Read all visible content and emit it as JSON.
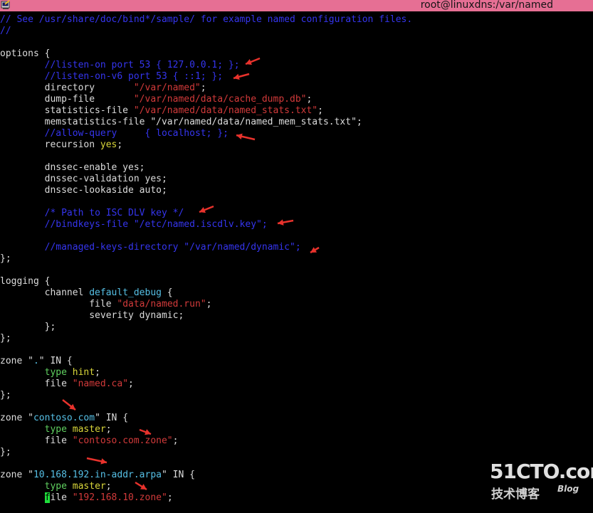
{
  "window": {
    "title": "root@linuxdns:/var/named",
    "icon": "putty-terminal-icon",
    "titlebar_color": "#e66f94"
  },
  "terminal": {
    "lines": [
      [
        {
          "t": "// See /usr/share/doc/bind*/sample/ for example named configuration files.",
          "c": "comment"
        }
      ],
      [
        {
          "t": "//",
          "c": "comment"
        }
      ],
      [],
      [
        {
          "t": "options {",
          "c": "kw"
        }
      ],
      [
        {
          "t": "        ",
          "c": "kw"
        },
        {
          "t": "//listen-on port 53 { 127.0.0.1; };",
          "c": "comment"
        }
      ],
      [
        {
          "t": "        ",
          "c": "kw"
        },
        {
          "t": "//listen-on-v6 port 53 { ::1; };",
          "c": "comment"
        }
      ],
      [
        {
          "t": "        directory       ",
          "c": "kw"
        },
        {
          "t": "\"/var/named\"",
          "c": "str"
        },
        {
          "t": ";",
          "c": "kw"
        }
      ],
      [
        {
          "t": "        dump-file       ",
          "c": "kw"
        },
        {
          "t": "\"/var/named/data/cache_dump.db\"",
          "c": "str"
        },
        {
          "t": ";",
          "c": "kw"
        }
      ],
      [
        {
          "t": "        statistics-file ",
          "c": "kw"
        },
        {
          "t": "\"/var/named/data/named_stats.txt\"",
          "c": "str"
        },
        {
          "t": ";",
          "c": "kw"
        }
      ],
      [
        {
          "t": "        memstatistics-file \"/var/named/data/named_mem_stats.txt\";",
          "c": "kw"
        }
      ],
      [
        {
          "t": "        ",
          "c": "kw"
        },
        {
          "t": "//allow-query     { localhost; };",
          "c": "comment"
        }
      ],
      [
        {
          "t": "        recursion ",
          "c": "kw"
        },
        {
          "t": "yes",
          "c": "val"
        },
        {
          "t": ";",
          "c": "kw"
        }
      ],
      [],
      [
        {
          "t": "        dnssec-enable yes;",
          "c": "kw"
        }
      ],
      [
        {
          "t": "        dnssec-validation yes;",
          "c": "kw"
        }
      ],
      [
        {
          "t": "        dnssec-lookaside auto;",
          "c": "kw"
        }
      ],
      [],
      [
        {
          "t": "        ",
          "c": "kw"
        },
        {
          "t": "/* Path to ISC DLV key */",
          "c": "comment"
        }
      ],
      [
        {
          "t": "        ",
          "c": "kw"
        },
        {
          "t": "//bindkeys-file \"/etc/named.iscdlv.key\";",
          "c": "comment"
        }
      ],
      [],
      [
        {
          "t": "        ",
          "c": "kw"
        },
        {
          "t": "//managed-keys-directory \"/var/named/dynamic\";",
          "c": "comment"
        }
      ],
      [
        {
          "t": "};",
          "c": "kw"
        }
      ],
      [],
      [
        {
          "t": "logging {",
          "c": "kw"
        }
      ],
      [
        {
          "t": "        channel ",
          "c": "kw"
        },
        {
          "t": "default_debug",
          "c": "blue"
        },
        {
          "t": " {",
          "c": "kw"
        }
      ],
      [
        {
          "t": "                file ",
          "c": "kw"
        },
        {
          "t": "\"data/named.run\"",
          "c": "str"
        },
        {
          "t": ";",
          "c": "kw"
        }
      ],
      [
        {
          "t": "                severity dynamic;",
          "c": "kw"
        }
      ],
      [
        {
          "t": "        };",
          "c": "kw"
        }
      ],
      [
        {
          "t": "};",
          "c": "kw"
        }
      ],
      [],
      [
        {
          "t": "zone \"",
          "c": "kw"
        },
        {
          "t": ".",
          "c": "blue"
        },
        {
          "t": "\" IN {",
          "c": "kw"
        }
      ],
      [
        {
          "t": "        ",
          "c": "kw"
        },
        {
          "t": "type",
          "c": "green"
        },
        {
          "t": " ",
          "c": "kw"
        },
        {
          "t": "hint",
          "c": "val"
        },
        {
          "t": ";",
          "c": "kw"
        }
      ],
      [
        {
          "t": "        file ",
          "c": "kw"
        },
        {
          "t": "\"named.ca\"",
          "c": "str"
        },
        {
          "t": ";",
          "c": "kw"
        }
      ],
      [
        {
          "t": "};",
          "c": "kw"
        }
      ],
      [],
      [
        {
          "t": "zone \"",
          "c": "kw"
        },
        {
          "t": "contoso.com",
          "c": "blue"
        },
        {
          "t": "\" IN {",
          "c": "kw"
        }
      ],
      [
        {
          "t": "        ",
          "c": "kw"
        },
        {
          "t": "type",
          "c": "green"
        },
        {
          "t": " ",
          "c": "kw"
        },
        {
          "t": "master",
          "c": "val"
        },
        {
          "t": ";",
          "c": "kw"
        }
      ],
      [
        {
          "t": "        file ",
          "c": "kw"
        },
        {
          "t": "\"contoso.com.zone\"",
          "c": "str"
        },
        {
          "t": ";",
          "c": "kw"
        }
      ],
      [
        {
          "t": "};",
          "c": "kw"
        }
      ],
      [],
      [
        {
          "t": "zone \"",
          "c": "kw"
        },
        {
          "t": "10.168.192.in-addr.arpa",
          "c": "blue"
        },
        {
          "t": "\" IN {",
          "c": "kw"
        }
      ],
      [
        {
          "t": "        ",
          "c": "kw"
        },
        {
          "t": "type",
          "c": "green"
        },
        {
          "t": " ",
          "c": "kw"
        },
        {
          "t": "master",
          "c": "val"
        },
        {
          "t": ";",
          "c": "kw"
        }
      ],
      [
        {
          "t": "        ",
          "c": "kw"
        },
        {
          "t": "f",
          "c": "cursor"
        },
        {
          "t": "ile ",
          "c": "kw"
        },
        {
          "t": "\"192.168.10.zone\"",
          "c": "str"
        },
        {
          "t": ";",
          "c": "kw"
        }
      ]
    ]
  },
  "watermark": {
    "main": "51CTO.com",
    "sub": "技术博客",
    "blog": "Blog"
  },
  "colors": {
    "background": "#000000",
    "comment": "#3535ee",
    "string": "#d23a3a",
    "value": "#d9d63a",
    "identifier": "#56c0e6",
    "cursor": "#1fe03c",
    "arrow": "#e8322c"
  }
}
